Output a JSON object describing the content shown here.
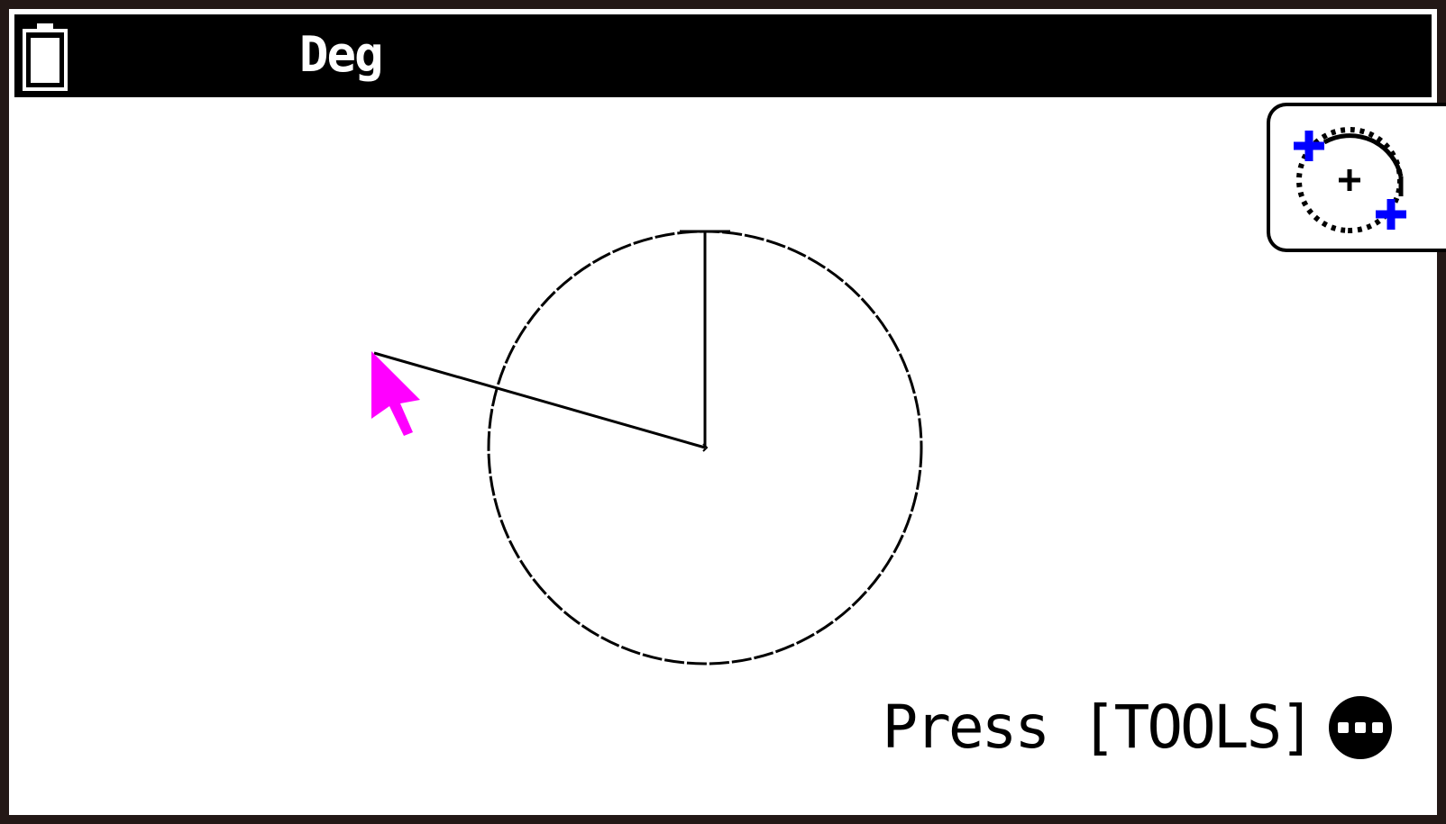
{
  "status_bar": {
    "angle_mode": "Deg",
    "battery_icon": "battery-icon"
  },
  "tool_panel": {
    "icon": "circle-drag-tool-icon",
    "accent_color": "#0000ff"
  },
  "cursor": {
    "icon": "pointer-cursor-icon",
    "color": "#ff00ff"
  },
  "hint": {
    "text": "Press [TOOLS]",
    "icon": "more-options-icon"
  }
}
